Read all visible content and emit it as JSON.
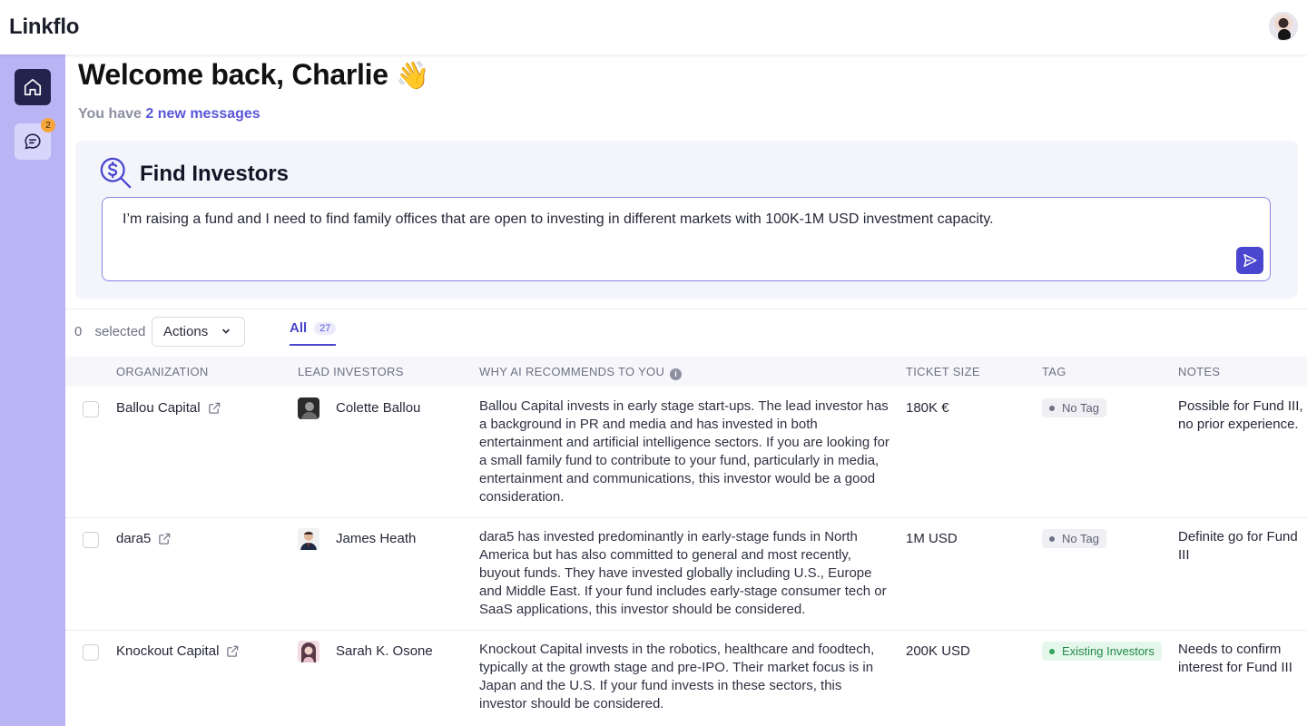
{
  "app": {
    "name": "Linkflo"
  },
  "sidebar": {
    "messages_badge": "2"
  },
  "welcome": {
    "title": "Welcome back, Charlie",
    "emoji": "👋",
    "sub_prefix": "You have",
    "sub_link": "2 new messages"
  },
  "find": {
    "title": "Find Investors",
    "query": "I’m raising a fund and I need to find family offices that are open to investing in different markets with 100K-1M USD investment capacity."
  },
  "toolbar": {
    "selected_count": "0",
    "selected_label": "selected",
    "actions_label": "Actions"
  },
  "tabs": [
    {
      "label": "All",
      "count": "27"
    }
  ],
  "table": {
    "headers": {
      "organization": "ORGANIZATION",
      "lead": "LEAD INVESTORS",
      "why": "WHY AI RECOMMENDS TO YOU",
      "ticket": "TICKET SIZE",
      "tag": "TAG",
      "notes": "NOTES"
    },
    "rows": [
      {
        "organization": "Ballou Capital",
        "lead": "Colette Ballou",
        "why": "Ballou Capital invests in early stage start-ups. The lead investor has a background in PR and media and has invested in both entertainment and artificial intelligence sectors. If you are looking for a small family fund to contribute to your fund, particularly in media, entertainment and communications, this investor would be a good consideration.",
        "ticket": "180K €",
        "tag": "No Tag",
        "notes": "Possible for Fund III, no prior experience."
      },
      {
        "organization": "dara5",
        "lead": "James Heath",
        "why": "dara5 has invested predominantly in early-stage funds in North America but has also committed to general and most recently, buyout funds. They have invested globally including U.S., Europe and Middle East. If your fund includes early-stage consumer tech or SaaS applications, this investor should be considered.",
        "ticket": "1M USD",
        "tag": "No Tag",
        "notes": "Definite go for Fund III"
      },
      {
        "organization": "Knockout Capital",
        "lead": "Sarah K. Osone",
        "why": "Knockout Capital invests in the robotics, healthcare and foodtech, typically at the growth stage and pre-IPO. Their market focus is in Japan and the U.S. If your fund invests in these sectors, this investor should be considered.",
        "ticket": "200K USD",
        "tag": "Existing Investors",
        "notes": "Needs to confirm interest for Fund III"
      }
    ]
  },
  "colors": {
    "accent": "#4a46cf",
    "sidebar": "#b9b5f5",
    "badge": "#f5a53b",
    "tag_existing": "#23884a"
  }
}
